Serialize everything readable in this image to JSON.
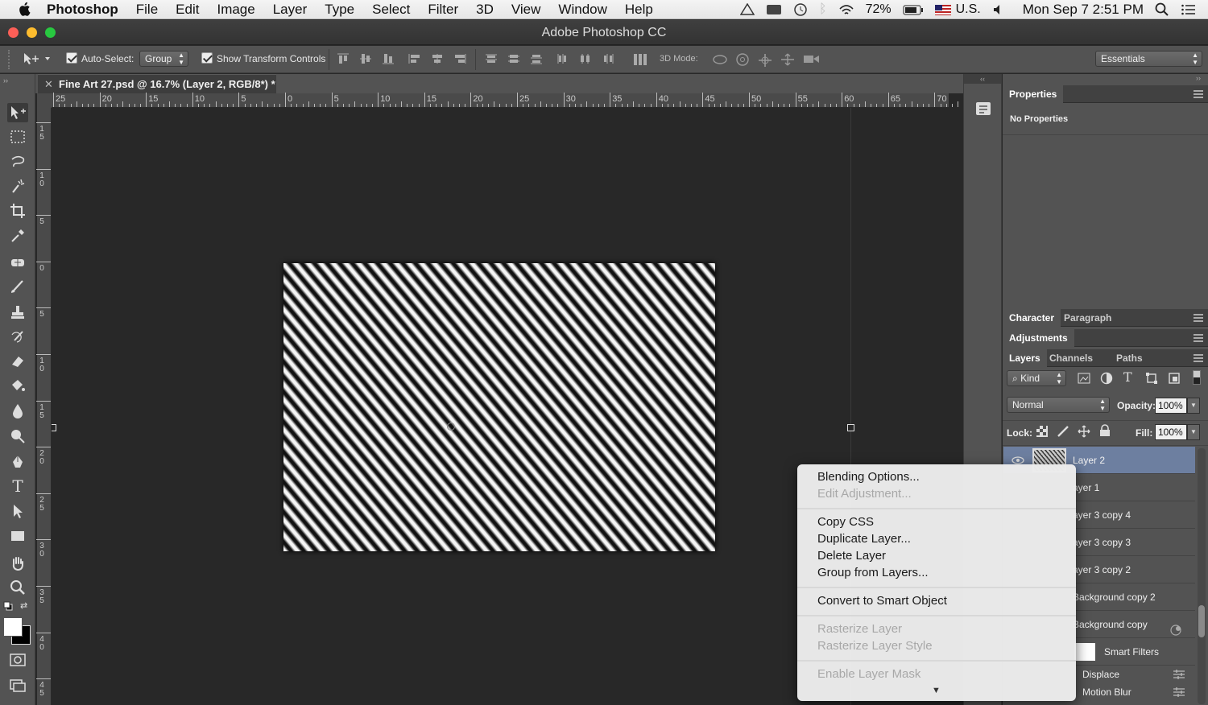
{
  "menubar": {
    "app": "Photoshop",
    "items": [
      "File",
      "Edit",
      "Image",
      "Layer",
      "Type",
      "Select",
      "Filter",
      "3D",
      "View",
      "Window",
      "Help"
    ],
    "battery": "72%",
    "input_source": "U.S.",
    "clock": "Mon Sep 7  2:51 PM"
  },
  "window": {
    "title": "Adobe Photoshop CC"
  },
  "options_bar": {
    "auto_select_label": "Auto-Select:",
    "auto_select_value": "Group",
    "transform_label": "Show Transform Controls",
    "mode3d_label": "3D Mode:",
    "workspace": "Essentials"
  },
  "document": {
    "tab_title": "Fine Art 27.psd @ 16.7% (Layer 2, RGB/8*) *"
  },
  "ruler": {
    "h_labels": [
      "25",
      "20",
      "15",
      "10",
      "5",
      "0",
      "5",
      "10",
      "15",
      "20",
      "25",
      "30",
      "35",
      "40",
      "45",
      "50",
      "55",
      "60",
      "65",
      "70"
    ],
    "v_labels": [
      "1\n5",
      "1\n0",
      "5",
      "0",
      "5",
      "1\n0",
      "1\n5",
      "2\n0",
      "2\n5",
      "3\n0",
      "3\n5",
      "4\n0",
      "4\n5"
    ]
  },
  "panels": {
    "properties": {
      "tab": "Properties",
      "content": "No Properties"
    },
    "character_tabs": [
      "Character",
      "Paragraph"
    ],
    "adjustments_tab": "Adjustments",
    "layers_tabs": [
      "Layers",
      "Channels",
      "Paths"
    ],
    "kind_filter": "Kind",
    "blend_mode": "Normal",
    "opacity_label": "Opacity:",
    "opacity_value": "100%",
    "lock_label": "Lock:",
    "fill_label": "Fill:",
    "fill_value": "100%",
    "layers": [
      {
        "name": "Layer 2"
      },
      {
        "name": "ayer 1"
      },
      {
        "name": "ayer 3 copy 4"
      },
      {
        "name": "ayer 3 copy 3"
      },
      {
        "name": "ayer 3 copy 2"
      },
      {
        "name": "Background copy 2"
      },
      {
        "name": "Background copy"
      }
    ],
    "smart_filters_label": "Smart Filters",
    "filters": [
      "Displace",
      "Motion Blur"
    ]
  },
  "context_menu": {
    "items": [
      {
        "label": "Blending Options...",
        "disabled": false
      },
      {
        "label": "Edit Adjustment...",
        "disabled": true
      },
      {
        "label": "Copy CSS",
        "disabled": false
      },
      {
        "label": "Duplicate Layer...",
        "disabled": false
      },
      {
        "label": "Delete Layer",
        "disabled": false
      },
      {
        "label": "Group from Layers...",
        "disabled": false
      },
      {
        "label": "Convert to Smart Object",
        "disabled": false
      },
      {
        "label": "Rasterize Layer",
        "disabled": true
      },
      {
        "label": "Rasterize Layer Style",
        "disabled": true
      },
      {
        "label": "Enable Layer Mask",
        "disabled": true
      }
    ]
  }
}
